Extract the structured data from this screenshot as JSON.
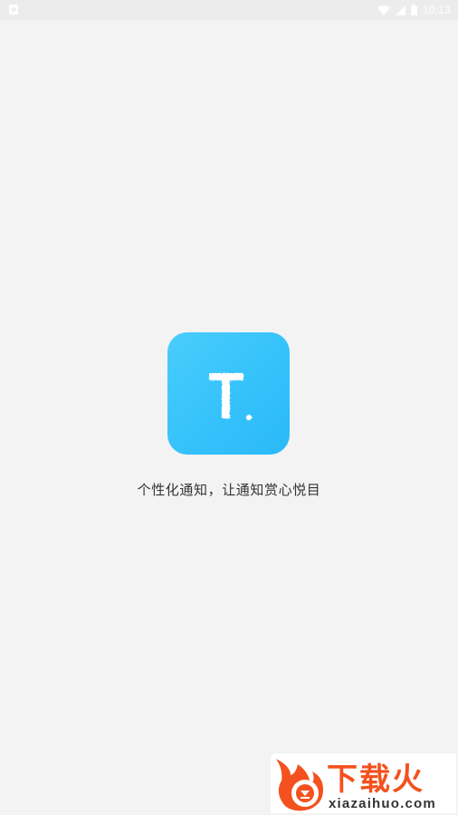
{
  "status_bar": {
    "time": "10:13",
    "icons": [
      "notification-icon",
      "wifi-icon",
      "signal-icon",
      "battery-icon"
    ]
  },
  "splash": {
    "logo_letter": "T.",
    "slogan": "个性化通知，让通知赏心悦目",
    "logo_colors": [
      "#49cdfb",
      "#2bb9f8"
    ]
  },
  "watermark": {
    "brand": "下载火",
    "domain": "xiazaihuo.com",
    "brand_color": "#f4511e"
  }
}
